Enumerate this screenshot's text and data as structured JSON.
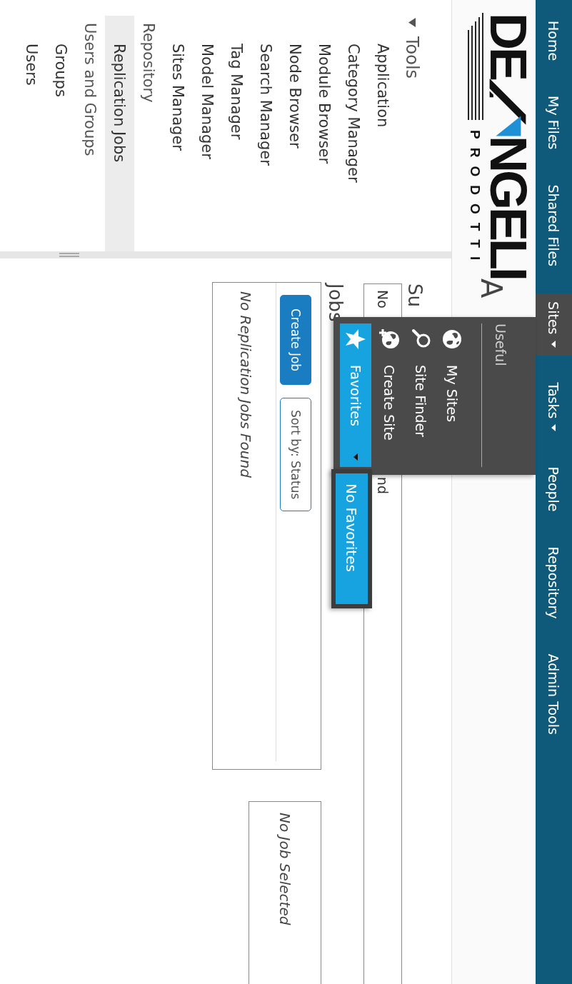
{
  "nav": {
    "items": [
      {
        "label": "Home",
        "selected": false,
        "has_menu": false
      },
      {
        "label": "My Files",
        "selected": false,
        "has_menu": false
      },
      {
        "label": "Shared Files",
        "selected": false,
        "has_menu": false
      },
      {
        "label": "Sites",
        "selected": true,
        "has_menu": true
      },
      {
        "label": "Tasks",
        "selected": false,
        "has_menu": true
      },
      {
        "label": "People",
        "selected": false,
        "has_menu": false
      },
      {
        "label": "Repository",
        "selected": false,
        "has_menu": false
      },
      {
        "label": "Admin Tools",
        "selected": false,
        "has_menu": false
      }
    ]
  },
  "logo": {
    "text_left": "DE",
    "text_right": "NGELI",
    "tagline": "PRODOTTI"
  },
  "page_title": "A",
  "sidebar": {
    "items": [
      {
        "label": "Tools",
        "kind": "section",
        "expanded": true,
        "children": [
          {
            "label": "Application",
            "selected": false
          },
          {
            "label": "Category Manager",
            "selected": false
          },
          {
            "label": "Module Browser",
            "selected": false
          },
          {
            "label": "Node Browser",
            "selected": false
          },
          {
            "label": "Search Manager",
            "selected": false
          },
          {
            "label": "Tag Manager",
            "selected": false
          },
          {
            "label": "Model Manager",
            "selected": false
          },
          {
            "label": "Sites Manager",
            "selected": false
          }
        ]
      },
      {
        "label": "Repository",
        "kind": "group",
        "children": [
          {
            "label": "Replication Jobs",
            "selected": true
          }
        ]
      },
      {
        "label": "Users and Groups",
        "kind": "group",
        "children": [
          {
            "label": "Groups",
            "selected": false
          },
          {
            "label": "Users",
            "selected": false
          }
        ]
      }
    ]
  },
  "summary": {
    "heading": "Su",
    "field_text_start": "No",
    "field_text_end": "nd"
  },
  "jobs": {
    "heading": "Jobs",
    "create_button": "Create Job",
    "sort_button": "Sort by: Status",
    "empty_text": "No Replication Jobs Found"
  },
  "detail": {
    "empty_text": "No Job Selected"
  },
  "sites_menu": {
    "header": "Useful",
    "items": [
      {
        "label": "My Sites",
        "kind": "globe"
      },
      {
        "label": "Site Finder",
        "kind": "search"
      },
      {
        "label": "Create Site",
        "kind": "globe-plus"
      }
    ],
    "favorites": {
      "label": "Favorites",
      "selected": true,
      "submenu": [
        "No Favorites"
      ]
    }
  }
}
